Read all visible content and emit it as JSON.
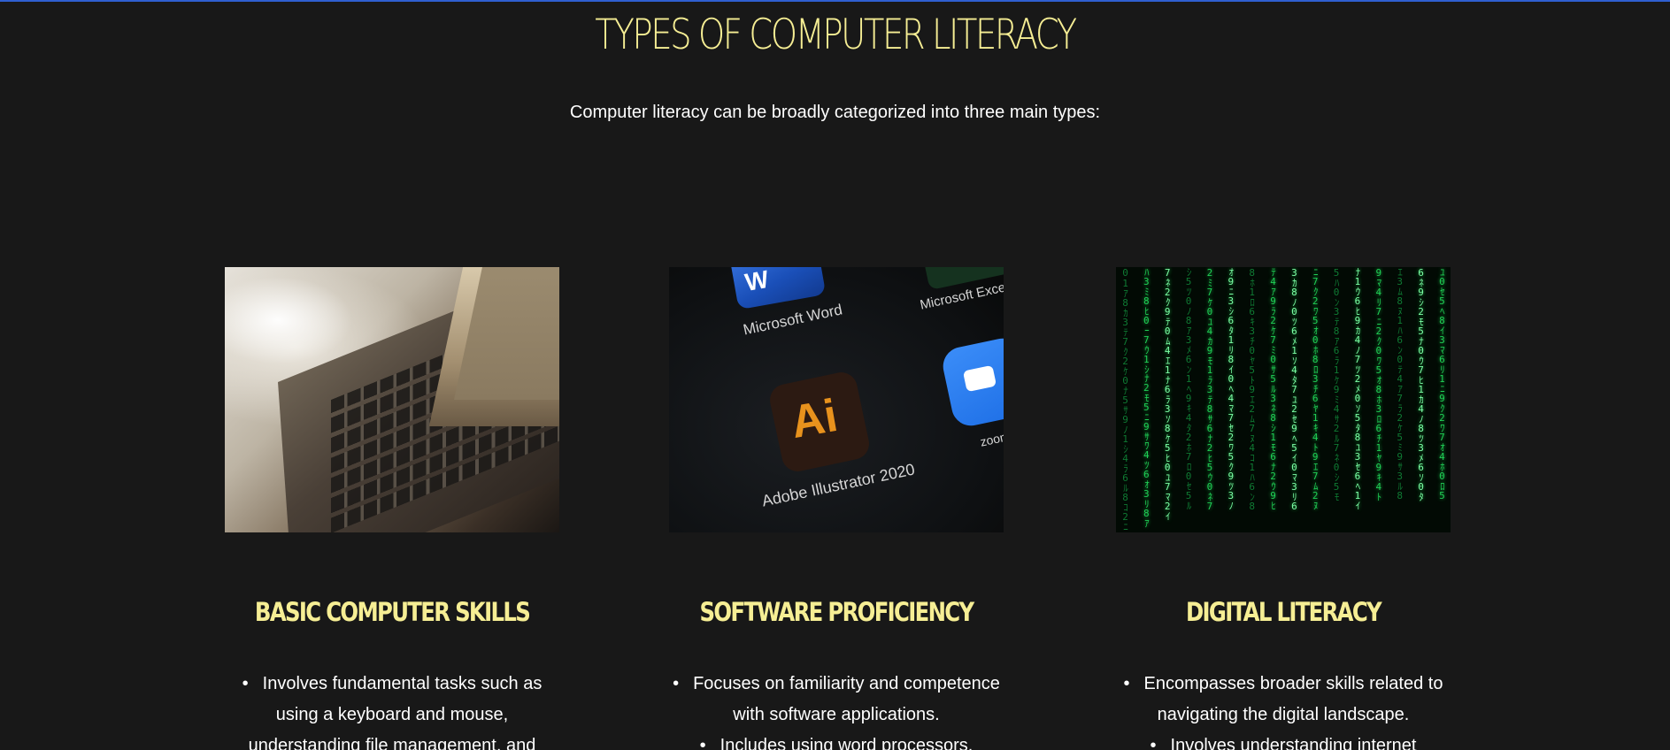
{
  "section": {
    "title": "TYPES OF COMPUTER LITERACY",
    "subtitle": "Computer literacy can be broadly categorized into three main types:"
  },
  "colors": {
    "background": "#181818",
    "accent": "#f6ee94",
    "text": "#ffffff",
    "top_border": "#2f5fd0"
  },
  "cards": [
    {
      "image_icon": "laptop-keyboard-photo",
      "title": "BASIC COMPUTER SKILLS",
      "bullets": [
        "Involves fundamental tasks such as using a keyboard and mouse, understanding file management, and"
      ]
    },
    {
      "image_icon": "app-icons-photo",
      "image_labels": {
        "word": "Microsoft Word",
        "word_letter": "W",
        "excel": "Microsoft Excel",
        "ai_letter": "Ai",
        "ai": "Adobe Illustrator 2020",
        "zoom": "zoom"
      },
      "title": "SOFTWARE PROFICIENCY",
      "bullets": [
        "Focuses on familiarity and competence with software applications.",
        "Includes using word processors,"
      ]
    },
    {
      "image_icon": "matrix-code-photo",
      "title": "DIGITAL LITERACY",
      "bullets": [
        "Encompasses broader skills related to navigating the digital landscape.",
        "Involves understanding internet"
      ]
    }
  ]
}
